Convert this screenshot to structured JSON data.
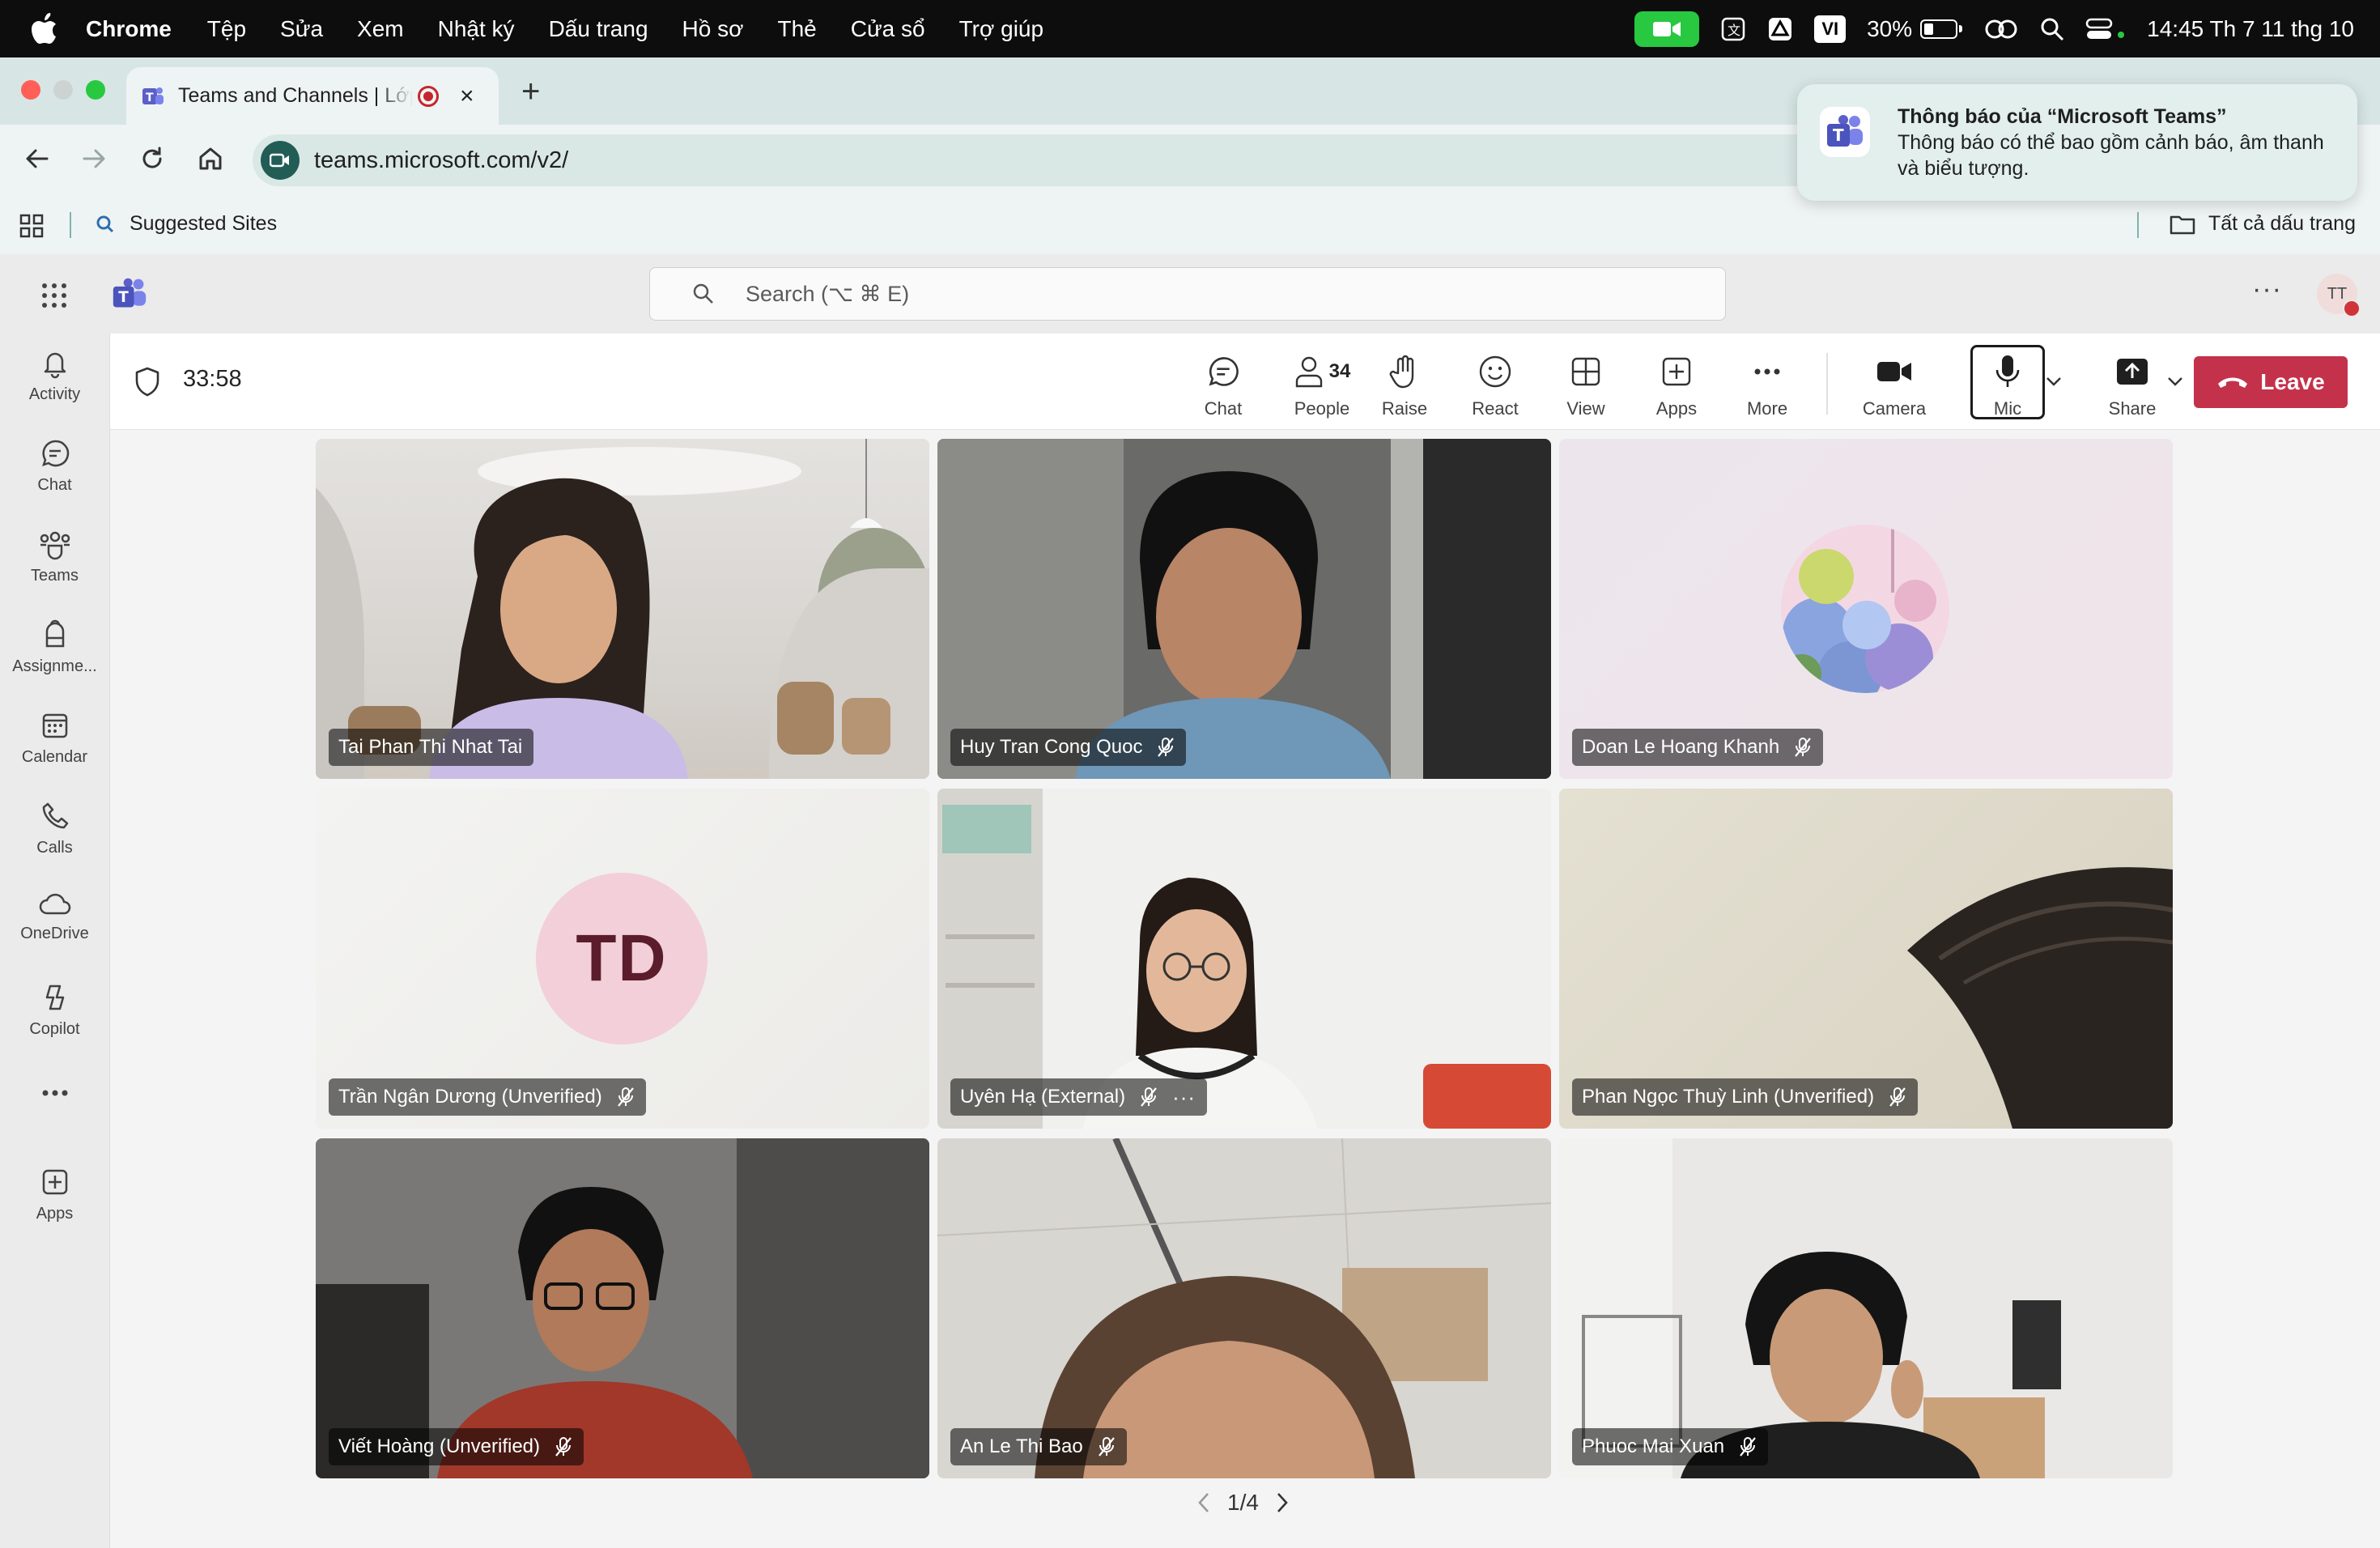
{
  "menubar": {
    "app": "Chrome",
    "items": [
      "Tệp",
      "Sửa",
      "Xem",
      "Nhật ký",
      "Dấu trang",
      "Hồ sơ",
      "Thẻ",
      "Cửa sổ",
      "Trợ giúp"
    ],
    "input_source": "VI",
    "battery": "30%",
    "battery_level": 0.3,
    "clock": "14:45 Th 7 11 thg 10"
  },
  "browser": {
    "tab_title": "Teams and Channels | Lớp",
    "url": "teams.microsoft.com/v2/",
    "bookmark_suggested": "Suggested Sites",
    "bookmark_all": "Tất cả dấu trang"
  },
  "notification": {
    "title": "Thông báo của “Microsoft Teams”",
    "body": "Thông báo có thể bao gồm cảnh báo, âm thanh và biểu tượng."
  },
  "teams": {
    "search_placeholder": "Search (⌥ ⌘ E)",
    "user_initials": "TT",
    "rail": [
      "Activity",
      "Chat",
      "Teams",
      "Assignme...",
      "Calendar",
      "Calls",
      "OneDrive",
      "Copilot",
      "Apps"
    ]
  },
  "meeting": {
    "timer": "33:58",
    "controls": {
      "chat": "Chat",
      "people": "People",
      "people_count": "34",
      "raise": "Raise",
      "react": "React",
      "view": "View",
      "apps": "Apps",
      "more": "More",
      "camera": "Camera",
      "mic": "Mic",
      "share": "Share",
      "leave": "Leave"
    },
    "participants": [
      "Tai Phan Thi Nhat Tai",
      "Huy Tran Cong Quoc",
      "Doan Le Hoang Khanh",
      "Trần Ngân Dương (Unverified)",
      "Uyên Hạ (External)",
      "Phan Ngọc Thuỳ Linh (Unverified)",
      "Viết Hoàng (Unverified)",
      "An Le Thi Bao",
      "Phuoc Mai Xuan"
    ],
    "td_initials": "TD",
    "pager": "1/4"
  },
  "colors": {
    "leave": "#c4314b",
    "teams_purple": "#5b5fc7",
    "facetime_green": "#28c840"
  }
}
